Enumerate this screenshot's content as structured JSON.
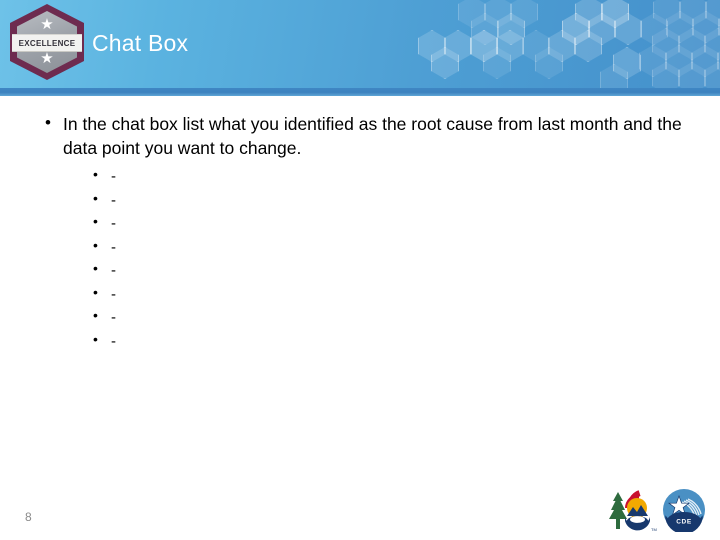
{
  "slide": {
    "title": "Chat Box",
    "page_number": "8",
    "background_color": "#ffffff"
  },
  "header": {
    "gradient_from": "#6ec2e8",
    "gradient_to": "#4490cb",
    "underline_color": "#3f87c4",
    "title": "Chat Box",
    "title_color": "#ffffff",
    "decoration": "hexagon-honeycomb-pattern"
  },
  "badge": {
    "label": "EXCELLENCE",
    "border_color": "#6e2b4f",
    "face_color": "#9ea3aa",
    "star_glyph": "★",
    "star_count": 2
  },
  "body": {
    "bullets": [
      {
        "text": "In the chat box list what you identified as the root cause from last month and the data point you want to change.",
        "sub_bullets": [
          "-",
          "-",
          "-",
          "-",
          "-",
          "-",
          "-",
          "-"
        ]
      }
    ]
  },
  "footer": {
    "logos": [
      {
        "name": "colorado-state-logo",
        "label": "Colorado",
        "colors": [
          "#2e6b3e",
          "#c8102e",
          "#f2a900",
          "#17386d"
        ]
      },
      {
        "name": "cde-logo",
        "label": "CDE",
        "colors": [
          "#4a90c4",
          "#17386d",
          "#ffffff"
        ]
      }
    ]
  }
}
